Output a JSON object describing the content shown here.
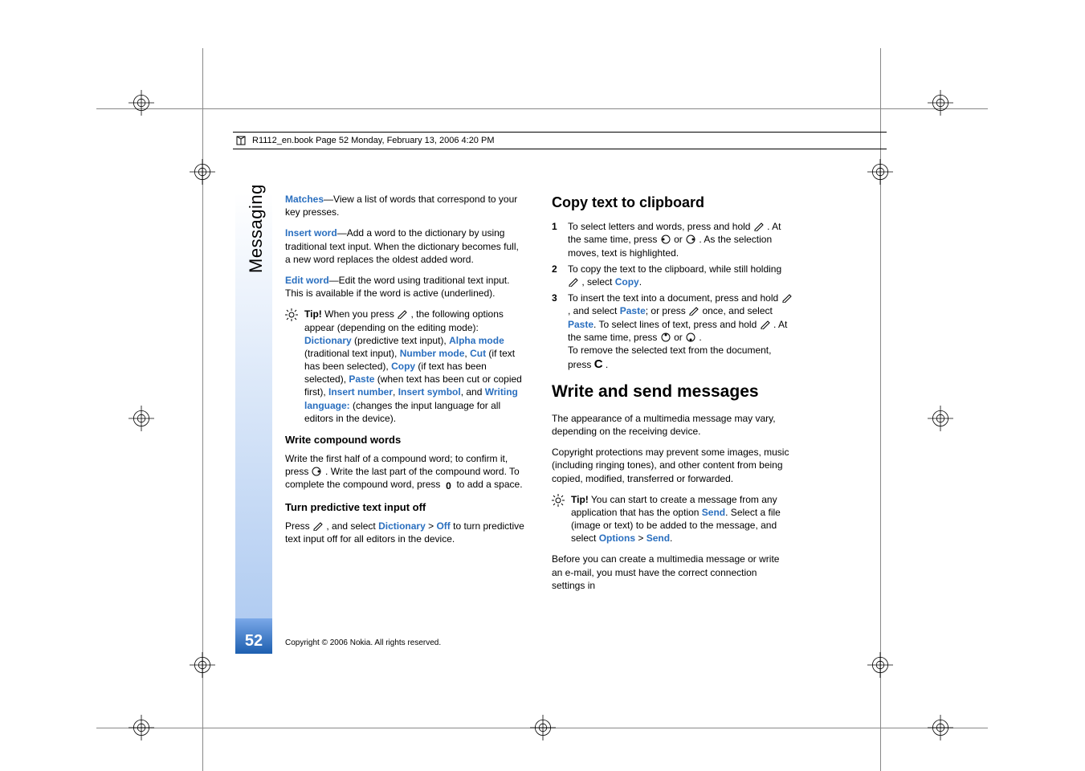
{
  "header": {
    "crop_text": "R1112_en.book  Page 52  Monday, February 13, 2006  4:20 PM"
  },
  "side_tab": "Messaging",
  "page_number": "52",
  "copyright": "Copyright © 2006 Nokia. All rights reserved.",
  "left_col": {
    "matches": {
      "kw": "Matches",
      "rest": "—View a list of words that correspond to your key presses."
    },
    "insert_word": {
      "kw": "Insert word",
      "rest": "—Add a word to the dictionary by using traditional text input. When the dictionary becomes full, a new word replaces the oldest added word."
    },
    "edit_word": {
      "kw": "Edit word",
      "rest": "—Edit the word using traditional text input. This is available if the word is active (underlined)."
    },
    "tip": {
      "label": "Tip!",
      "t1": " When you press ",
      "t2": " , the following options appear (depending on the editing mode): ",
      "dictionary": "Dictionary",
      "t3": " (predictive text input), ",
      "alpha": "Alpha mode",
      "t4": " (traditional text input), ",
      "number": "Number mode",
      "t5": ", ",
      "cut": "Cut",
      "t6": " (if text has been selected), ",
      "copy": "Copy",
      "t7": " (if text has been selected), ",
      "paste": "Paste",
      "t8": " (when text has been cut or copied first), ",
      "insnum": "Insert number",
      "inssym": "Insert symbol",
      "t9": ", and ",
      "wlang": "Writing language:",
      "t10": " (changes the input language for all editors in the device)."
    },
    "compound_h": "Write compound words",
    "compound_p": {
      "a": "Write the first half of a compound word; to confirm it, press ",
      "b": ". Write the last part of the compound word. To complete the compound word, press ",
      "c": " to add a space."
    },
    "turnoff_h": "Turn predictive text input off",
    "turnoff_p": {
      "a": "Press ",
      "b": " , and select ",
      "dict": "Dictionary",
      "c": " > ",
      "off": "Off",
      "d": " to turn predictive text input off for all editors in the device."
    }
  },
  "right_col": {
    "copy_h": "Copy text to clipboard",
    "li1": {
      "n": "1",
      "a": "To select letters and words, press and hold ",
      "b": " . At the same time, press ",
      "c": " or ",
      "d": ". As the selection moves, text is highlighted."
    },
    "li2": {
      "n": "2",
      "a": "To copy the text to the clipboard, while still holding ",
      "b": " , select ",
      "copy": "Copy",
      "c": "."
    },
    "li3": {
      "n": "3",
      "a": "To insert the text into a document, press and hold ",
      "b": " , and select ",
      "paste1": "Paste",
      "c": "; or press ",
      "d": " once, and select ",
      "paste2": "Paste",
      "e": ". To select lines of text, press and hold ",
      "f": " . At the same time, press ",
      "g": " or ",
      "h": ".",
      "i": "To remove the selected text from the document, press ",
      "j": " ."
    },
    "write_h": "Write and send messages",
    "p1": "The appearance of a multimedia message may vary, depending on the receiving device.",
    "p2": "Copyright protections may prevent some images, music (including ringing tones), and other content from being copied, modified, transferred or forwarded.",
    "tip": {
      "label": "Tip!",
      "a": " You can start to create a message from any application that has the option ",
      "send": "Send",
      "b": ". Select a file (image or text) to be added to the message, and select ",
      "options": "Options",
      "c": " > ",
      "send2": "Send",
      "d": "."
    },
    "p3": "Before you can create a multimedia message or write an e-mail, you must have the correct connection settings in"
  },
  "icons": {
    "pencil": "pencil-icon",
    "tip": "tip-bulb-icon",
    "nav_right": "nav-right-icon",
    "nav_left": "nav-left-icon",
    "nav_up": "nav-up-icon",
    "nav_down": "nav-down-icon",
    "zero": "key-zero-icon",
    "clear": "key-c-icon"
  }
}
